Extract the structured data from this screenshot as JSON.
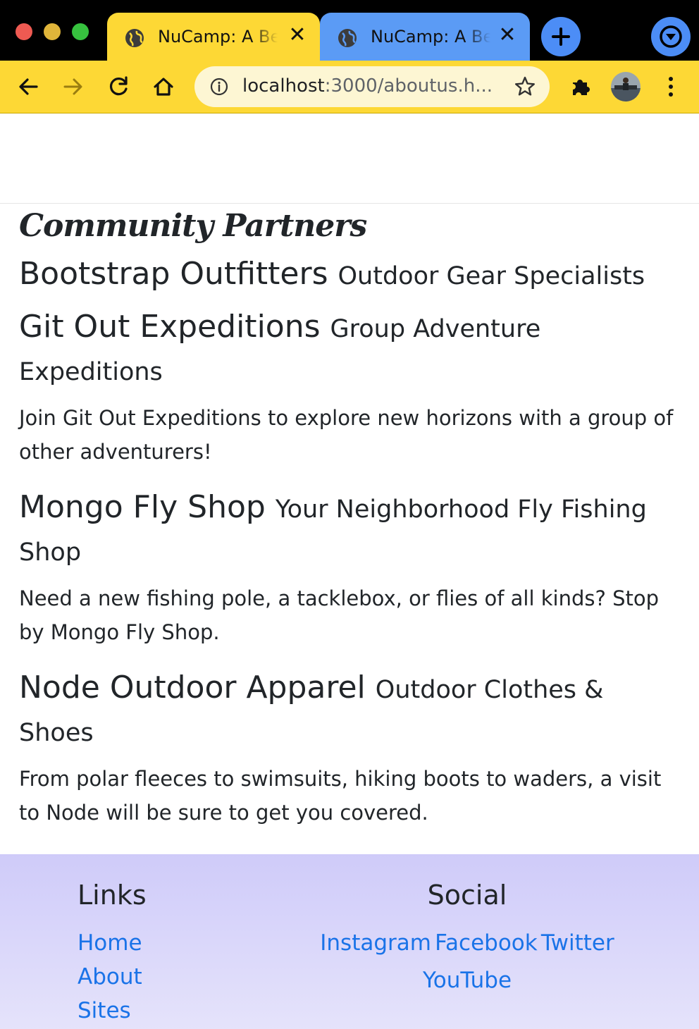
{
  "browser": {
    "tabs": [
      {
        "title": "NuCamp: A Better Way to Camp",
        "active": true
      },
      {
        "title": "NuCamp: A Better Way to Camp",
        "active": false
      }
    ],
    "url_host": "localhost",
    "url_rest": ":3000/aboutus.h..."
  },
  "colors": {
    "tab_active": "#fdd835",
    "tab_inactive": "#5b9bf5",
    "toolbar": "#fdd835",
    "link": "#1a73e8",
    "footer_top": "#cfcbf9"
  },
  "icons": [
    "globe-icon",
    "close-icon",
    "plus-icon",
    "chevron-down-icon",
    "back-arrow-icon",
    "forward-arrow-icon",
    "reload-icon",
    "home-icon",
    "info-icon",
    "star-icon",
    "extensions-icon",
    "profile-avatar",
    "menu-dots-icon"
  ],
  "main": {
    "section_title": "Community Partners",
    "partners": [
      {
        "name": "Bootstrap Outfitters",
        "tagline": "Outdoor Gear Specialists",
        "description": ""
      },
      {
        "name": "Git Out Expeditions",
        "tagline": "Group Adventure Expeditions",
        "description": "Join Git Out Expeditions to explore new horizons with a group of other adventurers!"
      },
      {
        "name": "Mongo Fly Shop",
        "tagline": "Your Neighborhood Fly Fishing Shop",
        "description": "Need a new fishing pole, a tacklebox, or flies of all kinds? Stop by Mongo Fly Shop."
      },
      {
        "name": "Node Outdoor Apparel",
        "tagline": "Outdoor Clothes & Shoes",
        "description": "From polar fleeces to swimsuits, hiking boots to waders, a visit to Node will be sure to get you covered."
      }
    ]
  },
  "footer": {
    "links_heading": "Links",
    "links": [
      "Home",
      "About",
      "Sites"
    ],
    "social_heading": "Social",
    "social": [
      "Instagram",
      "Facebook",
      "Twitter",
      "YouTube"
    ]
  }
}
